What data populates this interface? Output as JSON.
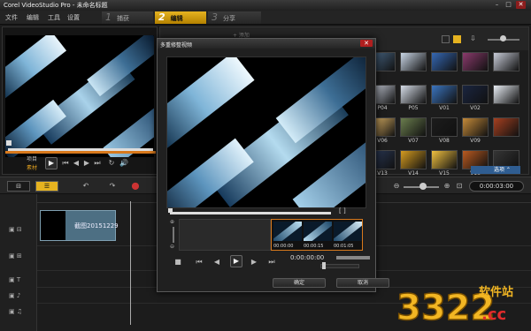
{
  "titlebar": {
    "title": "Corel VideoStudio Pro - 未命名标题",
    "min": "–",
    "max": "□",
    "close": "✕"
  },
  "menu": {
    "file": "文件",
    "edit": "编辑",
    "tools": "工具",
    "settings": "设置"
  },
  "steps": [
    {
      "num": "1",
      "label": "捕获"
    },
    {
      "num": "2",
      "label": "编辑"
    },
    {
      "num": "3",
      "label": "分享"
    }
  ],
  "preview": {
    "mode_project": "项目",
    "mode_clip": "素材",
    "buttons": {
      "play": "▶",
      "start": "⏮",
      "prev": "◀",
      "next": "▶",
      "end": "⏭",
      "repeat": "↻",
      "volume": "🔊"
    }
  },
  "library": {
    "new_label": "+ 添加",
    "sort_icon": "⇩",
    "options_label": "选项 ⌃",
    "thumbs": [
      {
        "label": "",
        "color": "#4a6a8a"
      },
      {
        "label": "",
        "color": "#c9d6e6"
      },
      {
        "label": "",
        "color": "#3568b4"
      },
      {
        "label": "",
        "color": "#8a3a6c"
      },
      {
        "label": "",
        "color": "#c8ccd8"
      },
      {
        "label": "P04",
        "color": "#cfd5e2"
      },
      {
        "label": "P05",
        "color": "#d6dde8"
      },
      {
        "label": "V01",
        "color": "#3b75bf"
      },
      {
        "label": "V02",
        "color": "#1a2540"
      },
      {
        "label": "",
        "color": "#e9eef5"
      },
      {
        "label": "V06",
        "color": "#e8bb6a"
      },
      {
        "label": "V07",
        "color": "#6a7d4d"
      },
      {
        "label": "V08",
        "color": "#1c1c1c"
      },
      {
        "label": "V09",
        "color": "#c48a39"
      },
      {
        "label": "",
        "color": "#a64020"
      },
      {
        "label": "V13",
        "color": "#2b3a5a"
      },
      {
        "label": "V14",
        "color": "#d49b20"
      },
      {
        "label": "V15",
        "color": "#f0c040"
      },
      {
        "label": "V16",
        "color": "#b95a20"
      },
      {
        "label": "",
        "color": "#353535"
      },
      {
        "label": "",
        "color": "#aa4422"
      },
      {
        "label": "",
        "color": "#a0a0a0"
      },
      {
        "label": "",
        "color": "#c8a060"
      },
      {
        "label": "",
        "color": "#88a0b8"
      },
      {
        "label": "",
        "color": "#d8d2c4"
      }
    ]
  },
  "timeline": {
    "storyboard_label": "⊟",
    "timeline_label": "☰",
    "undo": "↶",
    "redo": "↷",
    "record": "⬤",
    "zoom_out": "⊖",
    "zoom_in": "⊕",
    "fit": "⊡",
    "timecode": "0:00:03:00",
    "clip_label": "截图20151229"
  },
  "dialog": {
    "title": "多重修整视频",
    "close": "✕",
    "brackets": "[   ]",
    "frame_times": [
      "00:00:00",
      "00:00:15",
      "00:01:05"
    ],
    "timecode": "0:00:00:00",
    "ok": "确定",
    "cancel": "取消",
    "buttons": {
      "stop": "■",
      "start": "⏮",
      "prev": "◀",
      "play": "▶",
      "next": "▶",
      "end": "⏭"
    }
  },
  "watermark": {
    "number": "3322",
    "site": "软件站",
    "tld": ".cc"
  }
}
